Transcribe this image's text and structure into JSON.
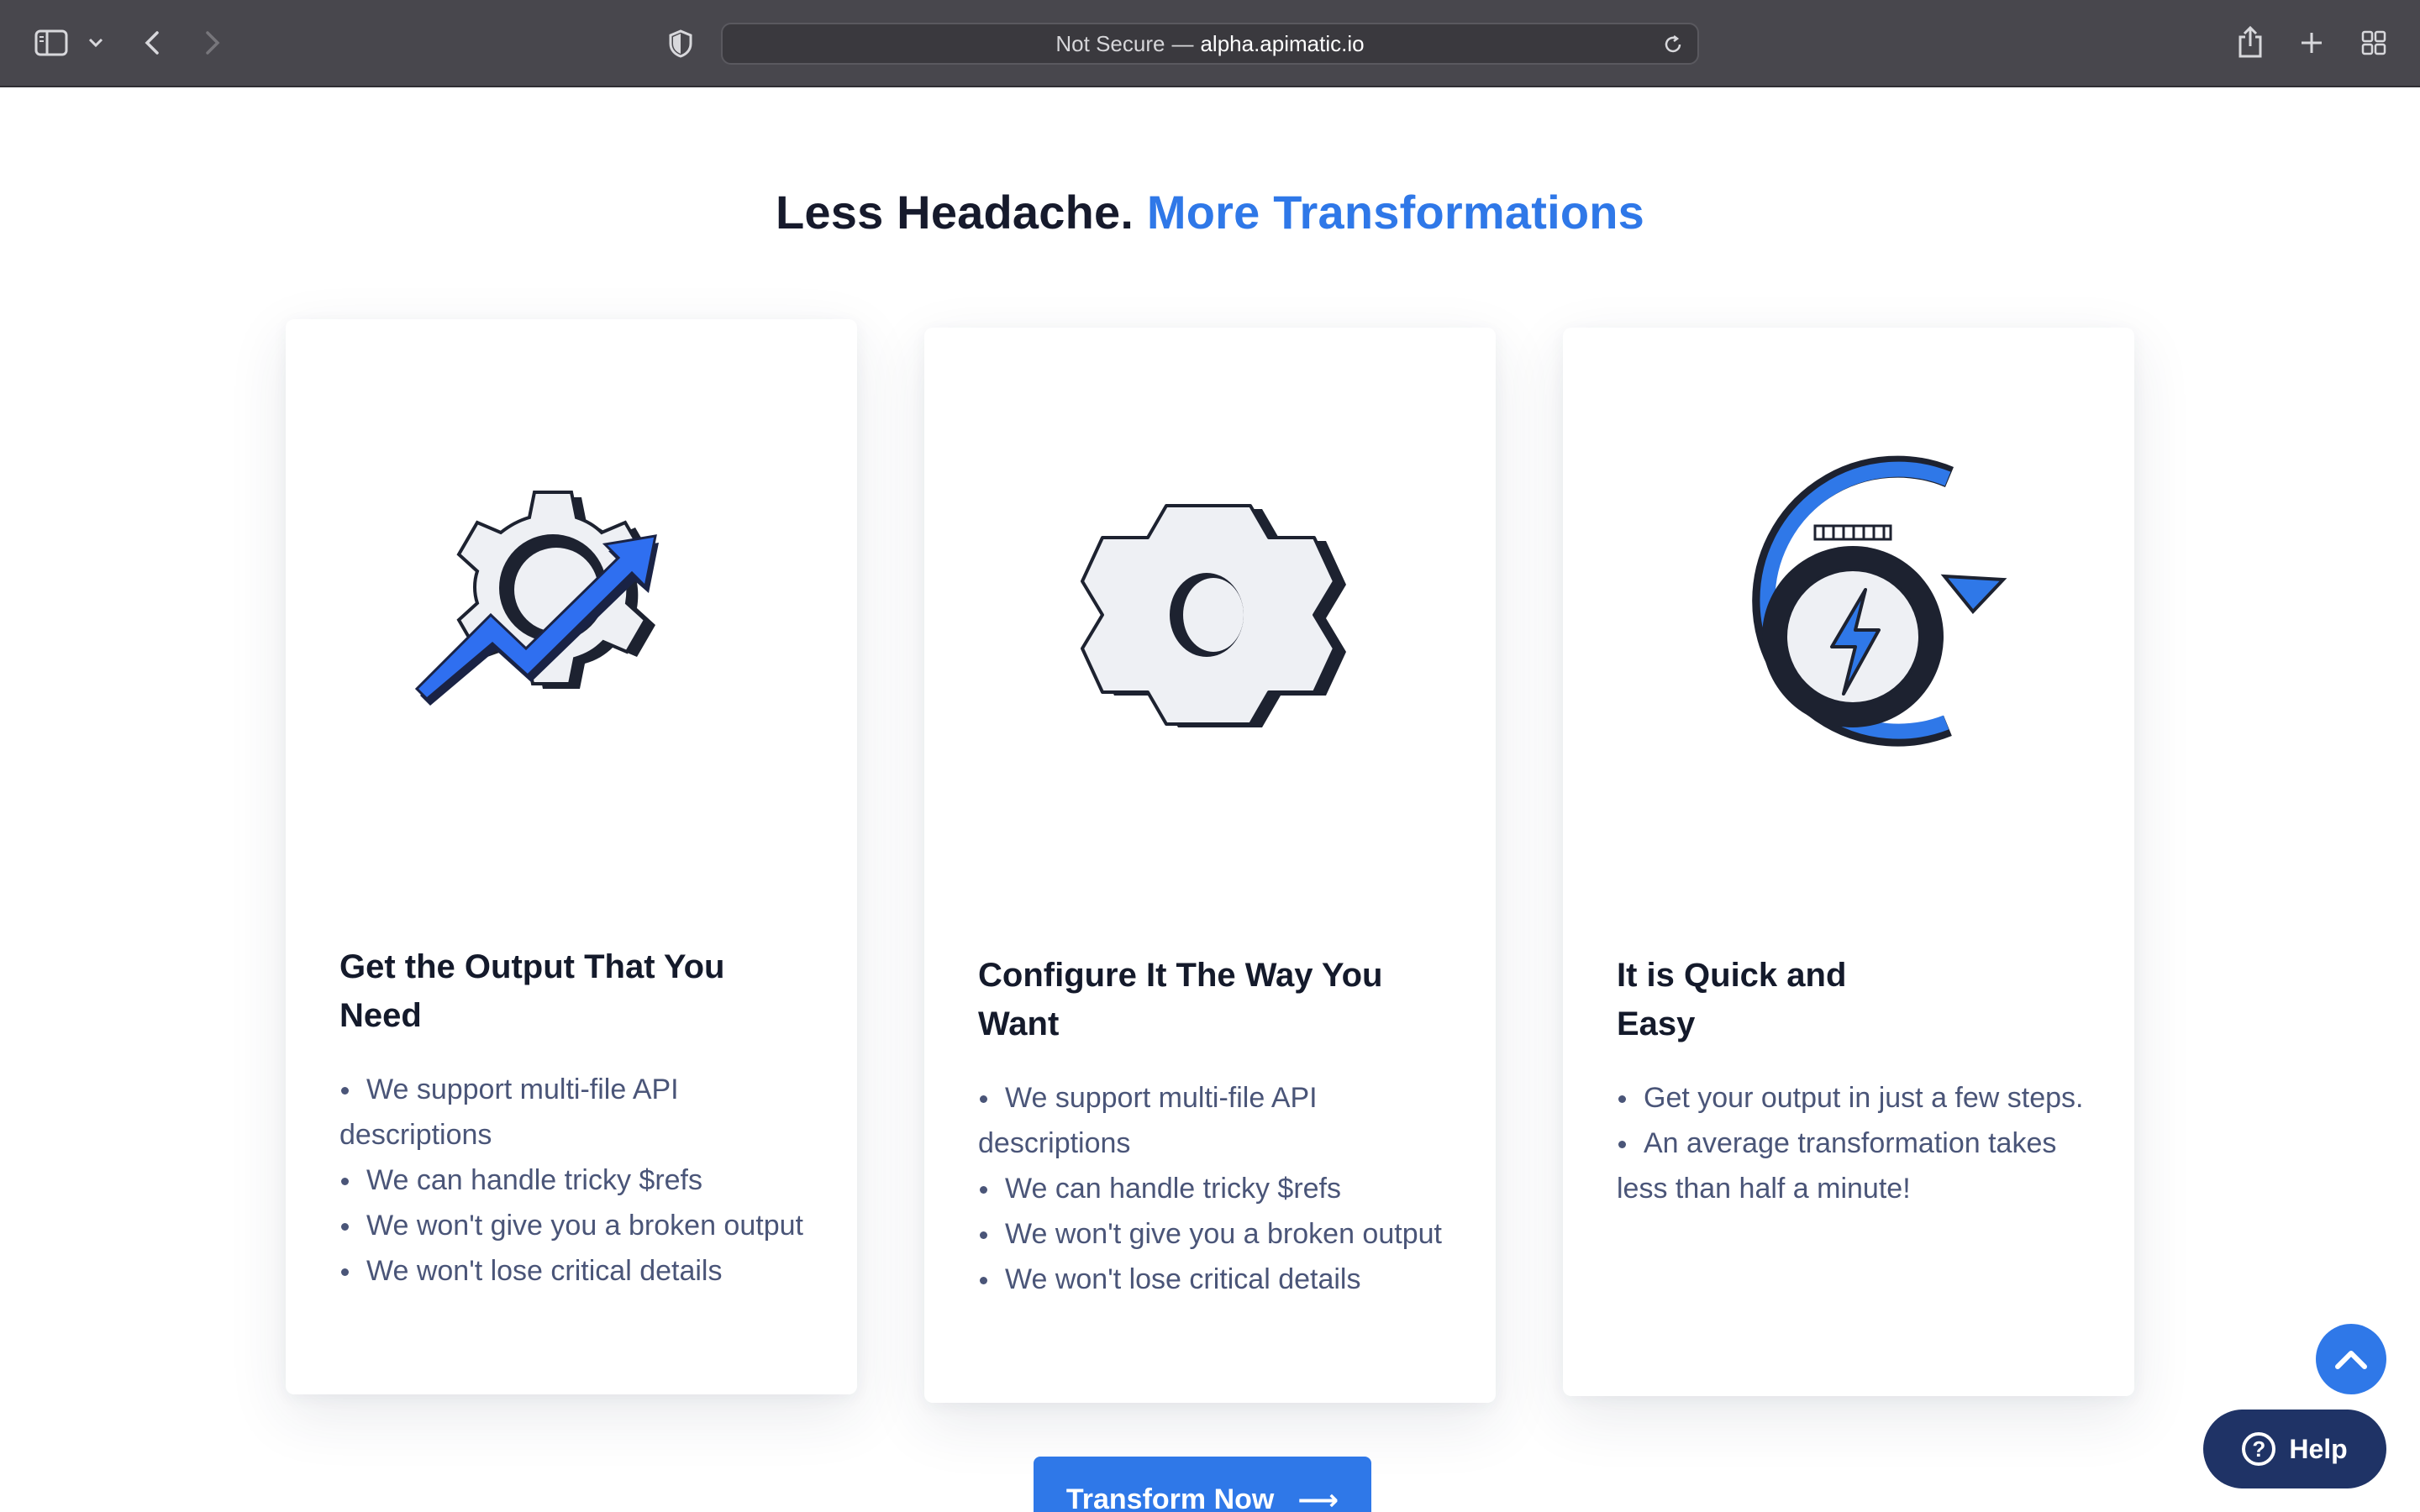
{
  "browser": {
    "url_security": "Not Secure",
    "url_separator": "—",
    "url_host": "alpha.apimatic.io"
  },
  "headline": {
    "main": "Less Headache.",
    "accent": "More Transformations"
  },
  "cards": [
    {
      "title_line1": "Get the Output That You",
      "title_line2": "Need",
      "icon": "gear-growth-arrow-icon",
      "items": [
        "We support multi-file API descriptions",
        "We can handle tricky $refs",
        "We won't give you a broken output",
        "We won't lose critical details"
      ]
    },
    {
      "title_line1": "Configure It The Way You",
      "title_line2": "Want",
      "icon": "gear-icon",
      "items": [
        "We support multi-file API descriptions",
        "We can handle tricky $refs",
        "We won't give you a broken output",
        "We won't lose critical details"
      ]
    },
    {
      "title_line1": "It is Quick and",
      "title_line2": "Easy",
      "icon": "fast-refresh-icon",
      "items": [
        "Get your output in just a few steps.",
        "An average transformation takes less than half a minute!"
      ]
    }
  ],
  "cta": {
    "label": "Transform Now",
    "arrow": "⟶"
  },
  "help": {
    "label": "Help",
    "glyph": "?"
  },
  "colors": {
    "accent": "#2f78e8",
    "navy": "#1f3366",
    "text": "#141a2b",
    "muted": "#4a5578"
  }
}
